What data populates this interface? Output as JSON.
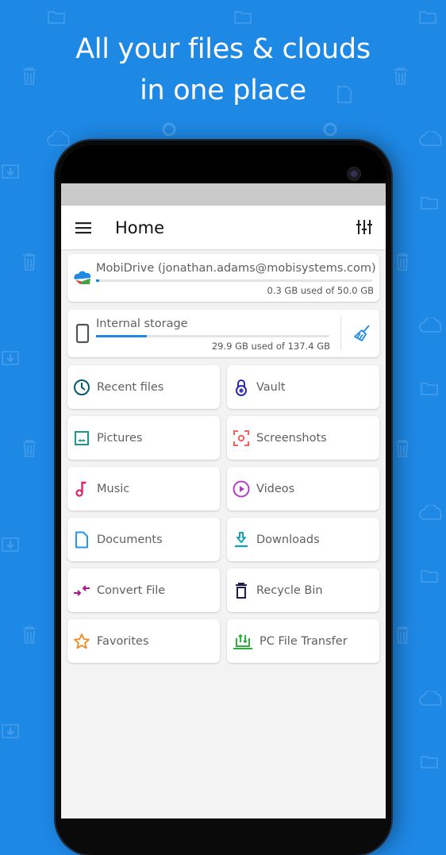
{
  "promo": {
    "headline_line1": "All your files & clouds",
    "headline_line2": "in one place"
  },
  "app_bar": {
    "title": "Home",
    "menu_icon": "hamburger-menu-icon",
    "filter_icon": "tune-sliders-icon"
  },
  "storage": [
    {
      "name": "MobiDrive (jonathan.adams@mobisystems.com)",
      "used_text": "0.3 GB used of 50.0 GB",
      "used_fraction": 0.006,
      "icon": "mobidrive-cloud-icon"
    },
    {
      "name": "Internal storage",
      "used_text": "29.9 GB used of 137.4 GB",
      "used_fraction": 0.218,
      "icon": "phone-device-icon",
      "action_icon": "broom-clean-icon"
    }
  ],
  "tiles": [
    {
      "label": "Recent files",
      "icon": "clock-icon",
      "color": "#00596b"
    },
    {
      "label": "Vault",
      "icon": "lock-icon",
      "color": "#2a2ab0"
    },
    {
      "label": "Pictures",
      "icon": "image-icon",
      "color": "#1a9a86"
    },
    {
      "label": "Screenshots",
      "icon": "screenshot-icon",
      "color": "#f06161"
    },
    {
      "label": "Music",
      "icon": "music-note-icon",
      "color": "#e91e63"
    },
    {
      "label": "Videos",
      "icon": "play-circle-icon",
      "color": "#b23cc8"
    },
    {
      "label": "Documents",
      "icon": "document-icon",
      "color": "#2196f3"
    },
    {
      "label": "Downloads",
      "icon": "download-icon",
      "color": "#12a3b8"
    },
    {
      "label": "Convert File",
      "icon": "convert-arrows-icon",
      "color": "#b0168a"
    },
    {
      "label": "Recycle Bin",
      "icon": "trash-icon",
      "color": "#1c1f4a"
    },
    {
      "label": "Favorites",
      "icon": "star-icon",
      "color": "#f08a1c"
    },
    {
      "label": "PC File Transfer",
      "icon": "pc-transfer-icon",
      "color": "#2fae3f"
    }
  ],
  "colors": {
    "background": "#1e88e5",
    "accent": "#1e88e5"
  }
}
